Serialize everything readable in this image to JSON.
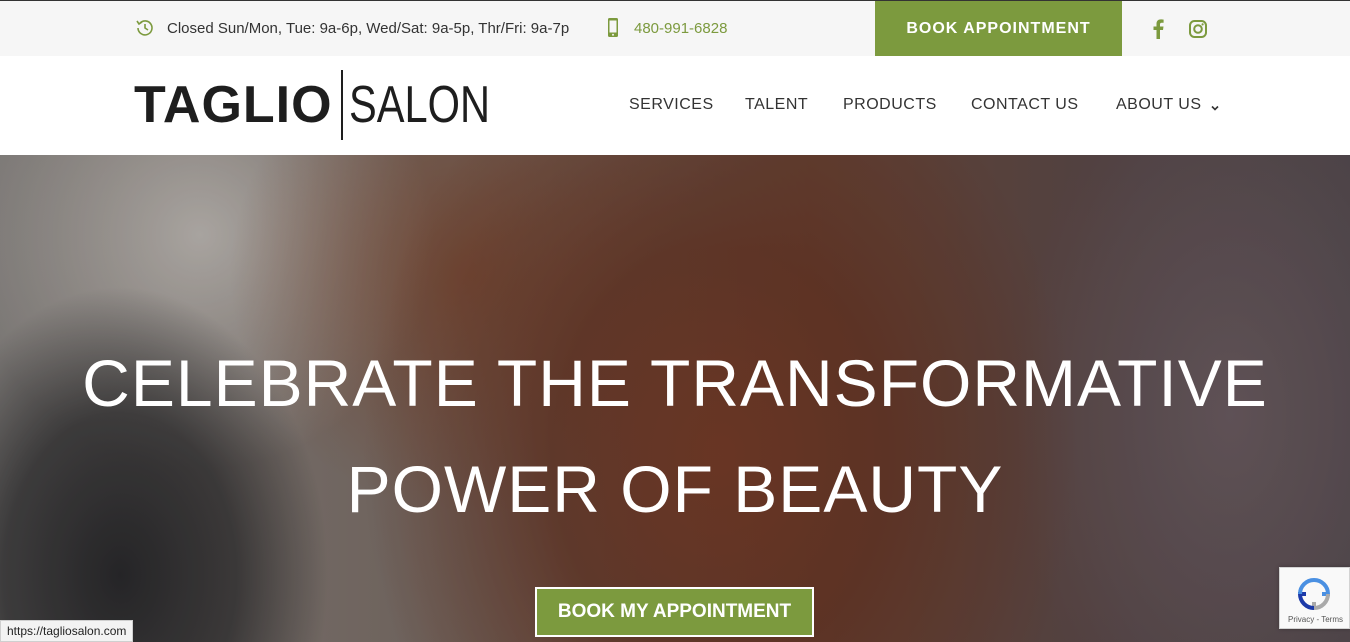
{
  "topbar": {
    "hours_icon": "clock-history-icon",
    "hours": "Closed Sun/Mon, Tue: 9a-6p, Wed/Sat: 9a-5p, Thr/Fri: 9a-7p",
    "phone_icon": "mobile-phone-icon",
    "phone": "480-991-6828",
    "book_label": "BOOK APPOINTMENT",
    "social": [
      "facebook-icon",
      "instagram-icon"
    ]
  },
  "header": {
    "logo_bold": "TAGLIO",
    "logo_light": "SALON",
    "nav": [
      {
        "label": "SERVICES"
      },
      {
        "label": "TALENT"
      },
      {
        "label": "PRODUCTS"
      },
      {
        "label": "CONTACT US"
      },
      {
        "label": "ABOUT US"
      }
    ]
  },
  "hero": {
    "line1": "CELEBRATE THE TRANSFORMATIVE",
    "line2": "POWER OF BEAUTY",
    "cta": "BOOK MY APPOINTMENT"
  },
  "status_url": "https://tagliosalon.com",
  "recaptcha": {
    "links": "Privacy - Terms"
  },
  "colors": {
    "accent": "#7c9a3e",
    "text": "#333333",
    "topbar_bg": "#f6f6f6"
  }
}
